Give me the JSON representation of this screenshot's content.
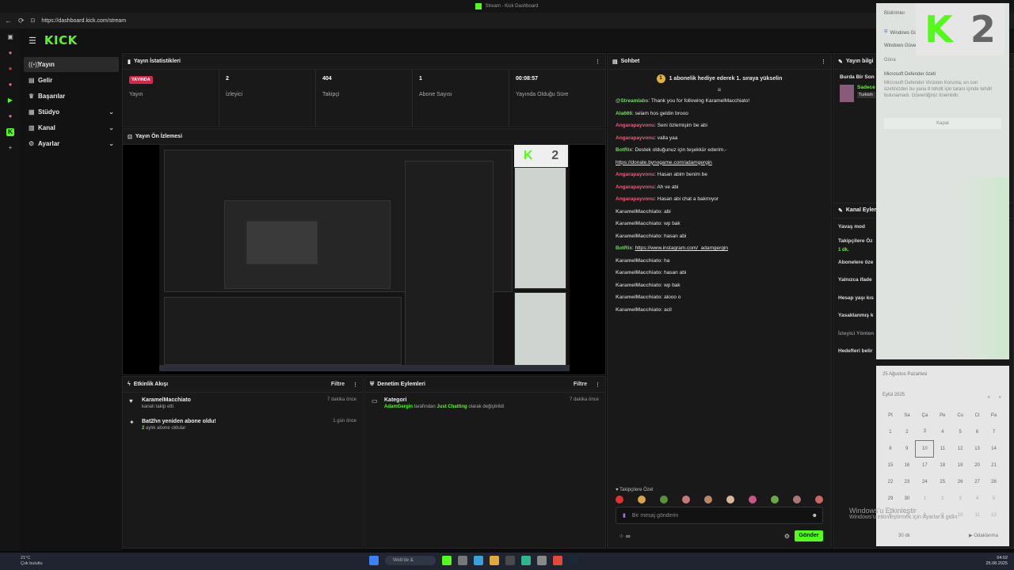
{
  "browser": {
    "tab_title": "Stream - Kick Dashboard",
    "url": "https://dashboard.kick.com/stream"
  },
  "header": {
    "logo": "KICK"
  },
  "sidebar": {
    "items": [
      {
        "label": "Yayın",
        "icon": "broadcast-icon"
      },
      {
        "label": "Gelir",
        "icon": "income-icon"
      },
      {
        "label": "Başarılar",
        "icon": "trophy-icon"
      },
      {
        "label": "Stüdyo",
        "icon": "studio-icon"
      },
      {
        "label": "Kanal",
        "icon": "channel-icon"
      },
      {
        "label": "Ayarlar",
        "icon": "settings-icon"
      }
    ]
  },
  "stats": {
    "title": "Yayın İstatistikleri",
    "items": [
      {
        "value": "YAYINDA",
        "label": "Yayın"
      },
      {
        "value": "2",
        "label": "İzleyici"
      },
      {
        "value": "404",
        "label": "Takipçi"
      },
      {
        "value": "1",
        "label": "Abone Sayısı"
      },
      {
        "value": "00:08:57",
        "label": "Yayında Olduğu Süre"
      }
    ]
  },
  "preview": {
    "title": "Yayın Ön İzlemesi"
  },
  "activity": {
    "title": "Etkinlik Akışı",
    "filter": "Filtre",
    "rows": [
      {
        "title": "KaramelMacchiato",
        "sub": "kanalı takip etti",
        "time": "7 dakika önce"
      },
      {
        "title": "Bat2hn yeniden abone oldu!",
        "sub_highlight": "2",
        "sub": "aylık abone oldular",
        "time": "1 gün önce"
      }
    ]
  },
  "moderation": {
    "title": "Denetim Eylemleri",
    "filter": "Filtre",
    "rows": [
      {
        "title": "Kategori",
        "user": "AdamGergin",
        "mid": "tarafından",
        "cat": "Just Chatting",
        "end": "olarak değiştirildi",
        "time": "7 dakika önce"
      }
    ]
  },
  "chat": {
    "title": "Sohbet",
    "gift_coin": "1",
    "gift_text": "1 abonelik hediye ederek 1. sıraya yükselin",
    "messages": [
      {
        "user": "@Streamlabs",
        "color": "#7ad36b",
        "text": "Thank you for following KaramelMacchiato!"
      },
      {
        "user": "Ala666",
        "color": "#7ad36b",
        "text": "selam hos geldin brooo"
      },
      {
        "user": "Angarapayvonu",
        "color": "#e3607a",
        "text": "Seni özlemişim be abi"
      },
      {
        "user": "Angarapayvonu",
        "color": "#e3607a",
        "text": "valla yaa"
      },
      {
        "user": "BotRix",
        "color": "#7ad36b",
        "text": "Destek olduğunuz için teşekkür ederim.-",
        "link": "https://donate.bynogame.com/adamgergin"
      },
      {
        "user": "Angarapayvonu",
        "color": "#e3607a",
        "text": "Hasan abim benim be"
      },
      {
        "user": "Angarapayvonu",
        "color": "#e3607a",
        "text": "Ah ve abi"
      },
      {
        "user": "Angarapayvonu",
        "color": "#e3607a",
        "text": "Hasan abi chat a bakmıyor"
      },
      {
        "user": "KaramelMacchiato",
        "color": "#b9b9b9",
        "text": "abi"
      },
      {
        "user": "KaramelMacchiato",
        "color": "#b9b9b9",
        "text": "wp bak"
      },
      {
        "user": "KaramelMacchiato",
        "color": "#b9b9b9",
        "text": "hasan abi"
      },
      {
        "user": "BotRix",
        "color": "#7ad36b",
        "text": "",
        "link": "https://www.instagram.com/_adamgergin"
      },
      {
        "user": "KaramelMacchiato",
        "color": "#b9b9b9",
        "text": "ha"
      },
      {
        "user": "KaramelMacchiato",
        "color": "#b9b9b9",
        "text": "hasan abi"
      },
      {
        "user": "KaramelMacchiato",
        "color": "#b9b9b9",
        "text": "wp bak"
      },
      {
        "user": "KaramelMacchiato",
        "color": "#b9b9b9",
        "text": "alooo o"
      },
      {
        "user": "KaramelMacchiato",
        "color": "#b9b9b9",
        "text": "acil"
      }
    ],
    "follow_only": "Takipçilere Özel",
    "input_placeholder": "Bir mesaj gönderin",
    "send": "Gönder"
  },
  "info": {
    "title": "Yayın bilgi",
    "line1": "Burda Bir Son",
    "line2": "Sadece",
    "line3": "Turkish",
    "channel_title": "Kanal Eylem",
    "rows": [
      "Yavaş mod",
      "Takipçilere Öz",
      "1 dk.",
      "Abonelere öze",
      "Yalnızca ifade",
      "Hesap yaşı kıs",
      "Yasaklanmış k",
      "İzleyici Yönten",
      "Hedefleri belir"
    ]
  },
  "notification": {
    "header": "Bildirimler",
    "app": "Windows Güv",
    "group": "Windows Güvenliği",
    "cat": "Güna",
    "title": "Microsoft Defender özeti",
    "body": "Microsoft Defender Virüsten Koruma, en son özetinizden bu yana 8 tehdit için taranı içinde tehdit bulunamadı. Güvenliğiniz önemlidir.",
    "button": "Kapat"
  },
  "calendar": {
    "header": "25 Ağustos Pazartesi",
    "month": "Eylül 2025",
    "weekdays": [
      "Pt",
      "Sa",
      "Ça",
      "Pe",
      "Cu",
      "Ct",
      "Pa"
    ],
    "weeks": [
      [
        "1",
        "2",
        "3",
        "4",
        "5",
        "6",
        "7"
      ],
      [
        "8",
        "9",
        "10",
        "11",
        "12",
        "13",
        "14"
      ],
      [
        "15",
        "16",
        "17",
        "18",
        "19",
        "20",
        "21"
      ],
      [
        "22",
        "23",
        "24",
        "25",
        "26",
        "27",
        "28"
      ],
      [
        "29",
        "30",
        "1",
        "2",
        "3",
        "4",
        "5"
      ],
      [
        "6",
        "7",
        "8",
        "9",
        "10",
        "11",
        "12"
      ]
    ],
    "foot_left": "30 dk",
    "foot_right": "Odaklanma"
  },
  "watermark": {
    "line1": "Windows'u Etkinleştir",
    "line2": "Windows'u etkinleştirmek için Ayarlar'a gidin."
  },
  "taskbar": {
    "temp": "21°C",
    "weather": "Çok bulutlu",
    "search": "Web'de &",
    "time": "04:02",
    "date": "25.08.2025"
  },
  "colors": {
    "accent": "#53fc18",
    "live": "#d8254a"
  }
}
